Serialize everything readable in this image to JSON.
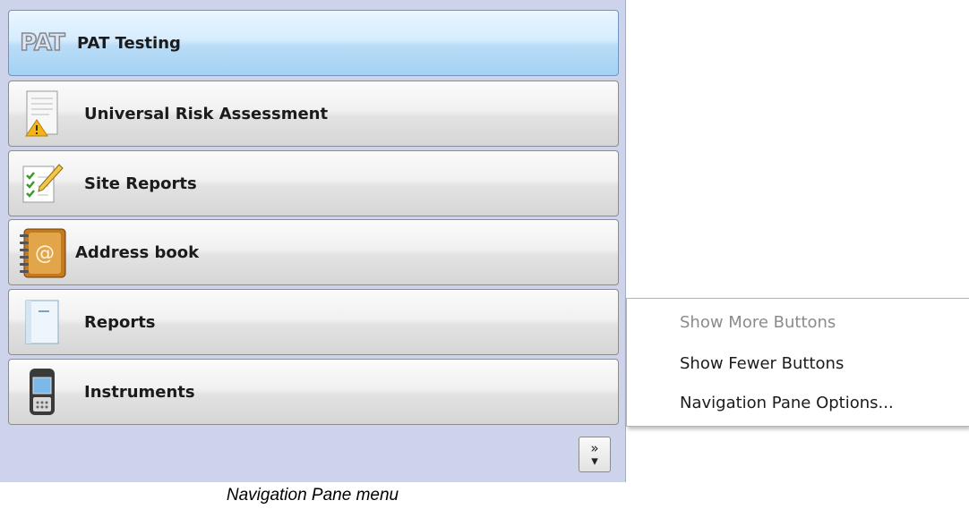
{
  "nav_pane": {
    "items": [
      {
        "label": "PAT Testing",
        "icon": "pat-logo-icon",
        "logo_text": "PAT",
        "selected": true
      },
      {
        "label": "Universal Risk Assessment",
        "icon": "risk-assessment-icon"
      },
      {
        "label": "Site Reports",
        "icon": "site-reports-icon"
      },
      {
        "label": "Address book",
        "icon": "address-book-icon"
      },
      {
        "label": "Reports",
        "icon": "reports-icon"
      },
      {
        "label": "Instruments",
        "icon": "instruments-icon"
      }
    ],
    "chevron_glyph": "»",
    "dropdown_glyph": "▾"
  },
  "context_menu": {
    "items": [
      {
        "label": "Show More Buttons",
        "enabled": false
      },
      {
        "label": "Show Fewer Buttons",
        "enabled": true
      },
      {
        "label": "Navigation Pane Options...",
        "enabled": true
      }
    ]
  },
  "caption": "Navigation Pane menu",
  "colors": {
    "pane_background": "#cdd3ea",
    "selected_button": "#b9dcf7",
    "disabled_text": "#8b8b8b"
  }
}
